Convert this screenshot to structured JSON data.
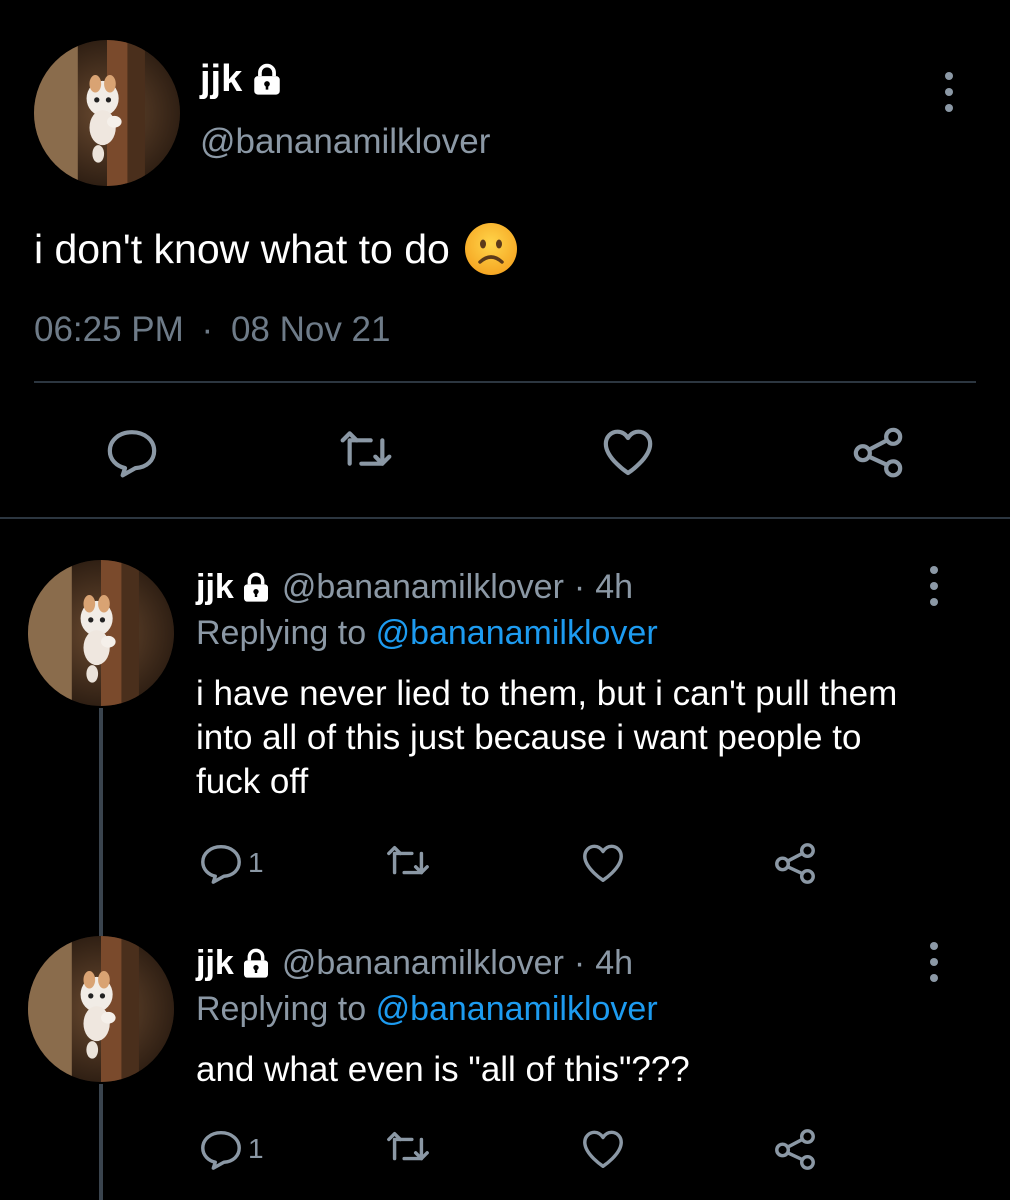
{
  "main_tweet": {
    "name": "jjk",
    "handle": "@bananamilklover",
    "text": "i don't know what to do",
    "emoji": "frowning-face",
    "time": "06:25 PM",
    "date_sep": "·",
    "date": "08 Nov 21"
  },
  "replies": [
    {
      "name": "jjk",
      "handle": "@bananamilklover",
      "separator": "·",
      "age": "4h",
      "replying_prefix": "Replying to",
      "replying_to": "@bananamilklover",
      "body": "i have never lied to them, but i can't pull them into all of this just because i want people to fuck off",
      "reply_count": "1"
    },
    {
      "name": "jjk",
      "handle": "@bananamilklover",
      "separator": "·",
      "age": "4h",
      "replying_prefix": "Replying to",
      "replying_to": "@bananamilklover",
      "body": "and what even is \"all of this\"???",
      "reply_count": "1"
    }
  ],
  "icons": {
    "reply": "speech-bubble-icon",
    "retweet": "retweet-icon",
    "like": "heart-icon",
    "share": "share-icon",
    "more": "vertical-dots-icon",
    "lock": "lock-icon"
  },
  "colors": {
    "background": "#000000",
    "text": "#ffffff",
    "muted": "#8b98a5",
    "link": "#1d9bf0",
    "divider": "#2c3640"
  }
}
